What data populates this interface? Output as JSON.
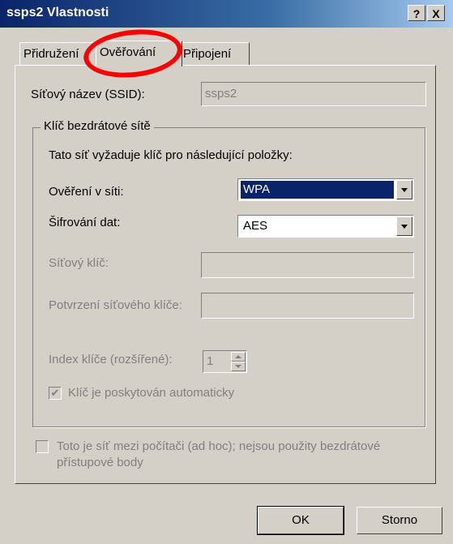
{
  "window": {
    "title": "ssps2 Vlastnosti",
    "help_label": "?",
    "close_label": "X"
  },
  "tabs": [
    {
      "label": "Přidružení"
    },
    {
      "label": "Ověřování"
    },
    {
      "label": "Připojení"
    }
  ],
  "ssid": {
    "label": "Síťový název (SSID):",
    "value": "ssps2"
  },
  "wireless_key": {
    "legend": "Klíč bezdrátové sítě",
    "description": "Tato síť vyžaduje klíč pro následující položky:",
    "auth_label": "Ověření v síti:",
    "auth_value": "WPA",
    "encryption_label": "Šifrování dat:",
    "encryption_value": "AES",
    "key_label": "Síťový klíč:",
    "key_value": "",
    "confirm_label": "Potvrzení síťového klíče:",
    "confirm_value": "",
    "index_label": "Index klíče (rozšířené):",
    "index_value": "1",
    "auto_key_label": "Klíč je poskytován automaticky",
    "auto_key_mark": "✔"
  },
  "adhoc": {
    "label": "Toto je síť mezi počítači (ad hoc); nejsou použity bezdrátové přístupové body"
  },
  "buttons": {
    "ok": "OK",
    "cancel": "Storno"
  }
}
